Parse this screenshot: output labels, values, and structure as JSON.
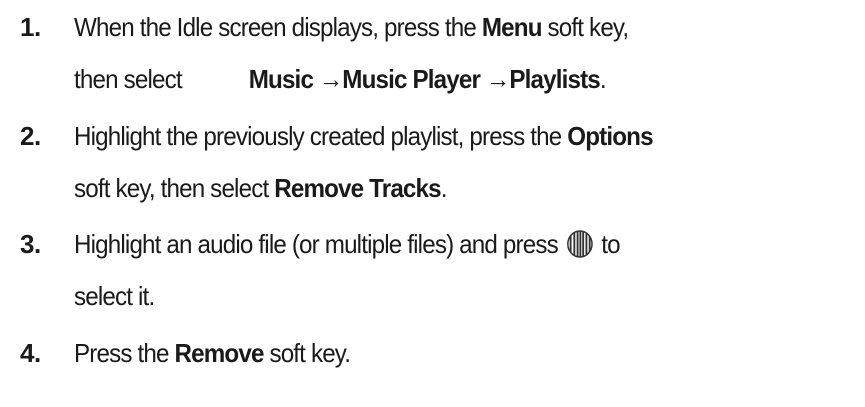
{
  "steps": [
    {
      "number": "1.",
      "line1": {
        "t1": "When the Idle screen displays, press the ",
        "b1": "Menu",
        "t2": " soft key,"
      },
      "line2": {
        "t1": "then select",
        "b1": "Music",
        "a1": "→",
        "b2": "Music Player",
        "a2": "→",
        "b3": "Playlists",
        "t2": "."
      }
    },
    {
      "number": "2.",
      "line1": {
        "t1": "Highlight the previously created playlist, press the ",
        "b1": "Options"
      },
      "line2": {
        "t1": "soft key, then select ",
        "b1": "Remove Tracks",
        "t2": "."
      }
    },
    {
      "number": "3.",
      "line1": {
        "t1": "Highlight an audio file (or multiple files) and press ",
        "icon": "center-select-key-icon",
        "t2": " to"
      },
      "line2": {
        "t1": "select it."
      }
    },
    {
      "number": "4.",
      "line1": {
        "t1": "Press the ",
        "b1": "Remove",
        "t2": " soft key."
      }
    }
  ]
}
